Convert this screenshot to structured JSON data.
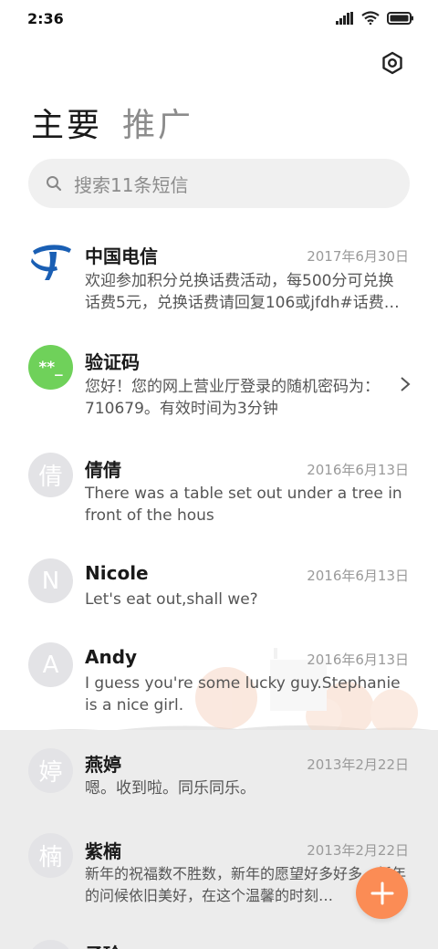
{
  "status": {
    "time": "2:36"
  },
  "tabs": {
    "primary": "主要",
    "promo": "推广"
  },
  "search": {
    "placeholder": "搜索11条短信"
  },
  "messages": [
    {
      "name": "中国电信",
      "date": "2017年6月30日",
      "preview": "欢迎参加积分兑换话费活动，每500分可兑换话费5元，兑换话费请回复106或jfdh#话费…",
      "avatar": "logo"
    },
    {
      "name": "验证码",
      "date": "",
      "preview": "您好！您的网上营业厅登录的随机密码为：710679。有效时间为3分钟",
      "avatar": "**_"
    },
    {
      "name": "倩倩",
      "date": "2016年6月13日",
      "preview": "There was a table set out under a tree in front of the hous",
      "avatar": "倩"
    },
    {
      "name": "Nicole",
      "date": "2016年6月13日",
      "preview": "Let's eat out,shall we?",
      "avatar": "N"
    },
    {
      "name": "Andy",
      "date": "2016年6月13日",
      "preview": "I guess you're some lucky guy.Stephanie is a nice girl.",
      "avatar": "A"
    },
    {
      "name": "燕婷",
      "date": "2013年2月22日",
      "preview": "嗯。收到啦。同乐同乐。",
      "avatar": "婷"
    },
    {
      "name": "紫楠",
      "date": "2013年2月22日",
      "preview": "新年的祝福数不胜数，新年的愿望好多好多，新年的问候依旧美好，在这个温馨的时刻…",
      "avatar": "楠"
    },
    {
      "name": "子玲",
      "date": "",
      "preview": "",
      "avatar": ""
    }
  ],
  "colors": {
    "accent": "#fb8c55",
    "verify_avatar": "#6fd15a",
    "telecom_blue": "#1a5fb4",
    "avatar_gray": "#e3e3e6"
  },
  "icons": {
    "settings": "settings-icon",
    "search": "search-icon",
    "compose": "plus-icon",
    "chevron": "chevron-right-icon"
  }
}
